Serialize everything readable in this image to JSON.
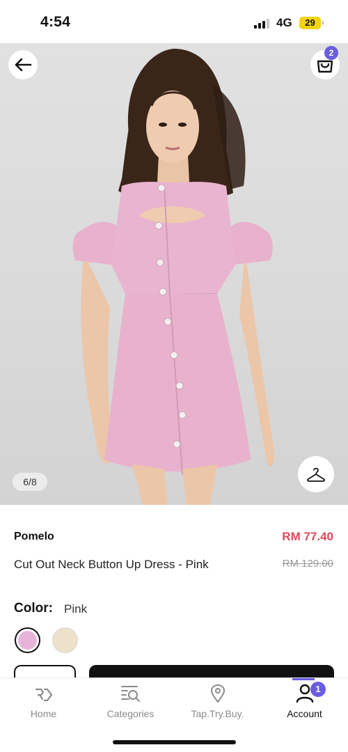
{
  "status_bar": {
    "time": "4:54",
    "network": "4G",
    "battery": "29"
  },
  "gallery": {
    "page_indicator": "6/8",
    "cart_count": "2"
  },
  "product": {
    "brand": "Pomelo",
    "name": "Cut Out Neck Button Up Dress - Pink",
    "price": "RM 77.40",
    "original_price": "RM 129.00",
    "color_label": "Color:",
    "selected_color": "Pink",
    "swatches": [
      {
        "name": "Pink",
        "color": "#e7b4d9"
      },
      {
        "name": "Cream",
        "color": "#ede1c9"
      }
    ]
  },
  "tab_bar": {
    "tabs": [
      {
        "label": "Home",
        "icon": "home-logo-icon"
      },
      {
        "label": "Categories",
        "icon": "categories-search-icon"
      },
      {
        "label": "Tap.Try.Buy.",
        "icon": "location-pin-icon"
      },
      {
        "label": "Account",
        "icon": "account-icon",
        "badge": "1",
        "active": true
      }
    ]
  },
  "colors": {
    "accent": "#6a5de0",
    "price": "#e0485a",
    "dress": "#e8b2cd",
    "background": "#ffffff"
  }
}
